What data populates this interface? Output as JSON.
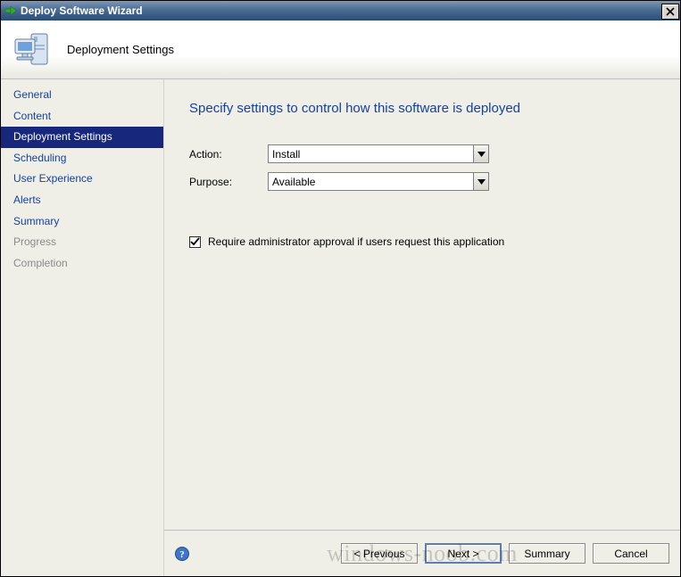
{
  "window": {
    "title": "Deploy Software Wizard"
  },
  "banner": {
    "label": "Deployment Settings"
  },
  "sidebar": {
    "items": [
      {
        "label": "General",
        "state": "normal"
      },
      {
        "label": "Content",
        "state": "normal"
      },
      {
        "label": "Deployment Settings",
        "state": "selected"
      },
      {
        "label": "Scheduling",
        "state": "normal"
      },
      {
        "label": "User Experience",
        "state": "normal"
      },
      {
        "label": "Alerts",
        "state": "normal"
      },
      {
        "label": "Summary",
        "state": "normal"
      },
      {
        "label": "Progress",
        "state": "disabled"
      },
      {
        "label": "Completion",
        "state": "disabled"
      }
    ]
  },
  "main": {
    "heading": "Specify settings to control how this software is deployed",
    "fields": {
      "action": {
        "label": "Action:",
        "value": "Install"
      },
      "purpose": {
        "label": "Purpose:",
        "value": "Available"
      }
    },
    "approval": {
      "checked": true,
      "label": "Require administrator approval if users request this application"
    }
  },
  "buttons": {
    "previous": "< Previous",
    "next": "Next >",
    "summary": "Summary",
    "cancel": "Cancel"
  },
  "watermark": "windows-noob.com"
}
